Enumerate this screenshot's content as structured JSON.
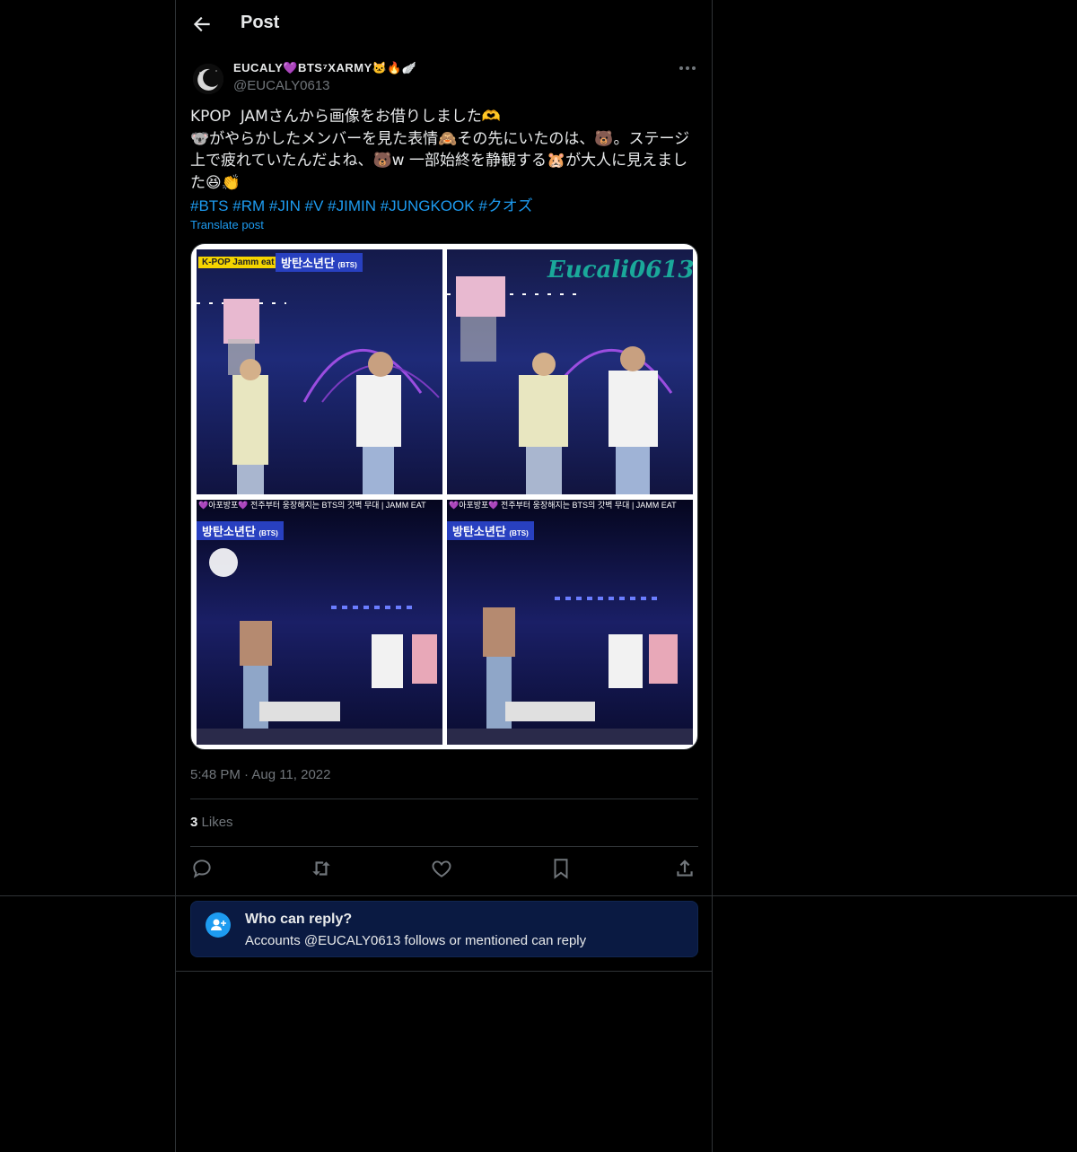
{
  "header": {
    "title": "Post"
  },
  "author": {
    "display_name": "EUCALY💜BTS⁷XARMY🐱‍🔥🪽",
    "handle": "@EUCALY0613"
  },
  "tweet": {
    "text": "KPOP  JAMさんから画像をお借りしました🫶\n🐨がやらかしたメンバーを見た表情🙈その先にいたのは、🐻。ステージ上で疲れていたんだよね、🐻w 一部始終を静観する🐹が大人に見えました😆👏",
    "hashtags": [
      "#BTS",
      "#RM",
      "#JIN",
      "#V",
      "#JIMIN",
      "#JUNGKOOK",
      "#クオズ"
    ],
    "translate_label": "Translate post",
    "timestamp": "5:48 PM · Aug 11, 2022",
    "likes_count": "3",
    "likes_label": "Likes"
  },
  "media": {
    "watermark": "Eucali0613",
    "panel1_tag": "K-POP Jamm eat",
    "panel1_title": "방탄소년단",
    "panel1_sub": "(BTS)",
    "panel3_caption": "💜아포방포💜 전주부터 웅장해지는 BTS의 갓벽 무대 | JAMM EAT",
    "panel4_caption": "💜아포방포💜 전주부터 웅장해지는 BTS의 갓벽 무대 | JAMM EAT",
    "panel3_title": "방탄소년단",
    "panel3_sub": "(BTS)",
    "panel4_title": "방탄소년단",
    "panel4_sub": "(BTS)"
  },
  "reply_restriction": {
    "title": "Who can reply?",
    "subtitle": "Accounts @EUCALY0613 follows or mentioned can reply"
  },
  "colors": {
    "accent": "#1d9bf0",
    "background": "#000000",
    "muted": "#71767b",
    "reply_box": "#0a1a42"
  },
  "icons": [
    "back-arrow-icon",
    "more-icon",
    "reply-icon",
    "retweet-icon",
    "like-icon",
    "bookmark-icon",
    "share-icon",
    "add-user-icon"
  ]
}
